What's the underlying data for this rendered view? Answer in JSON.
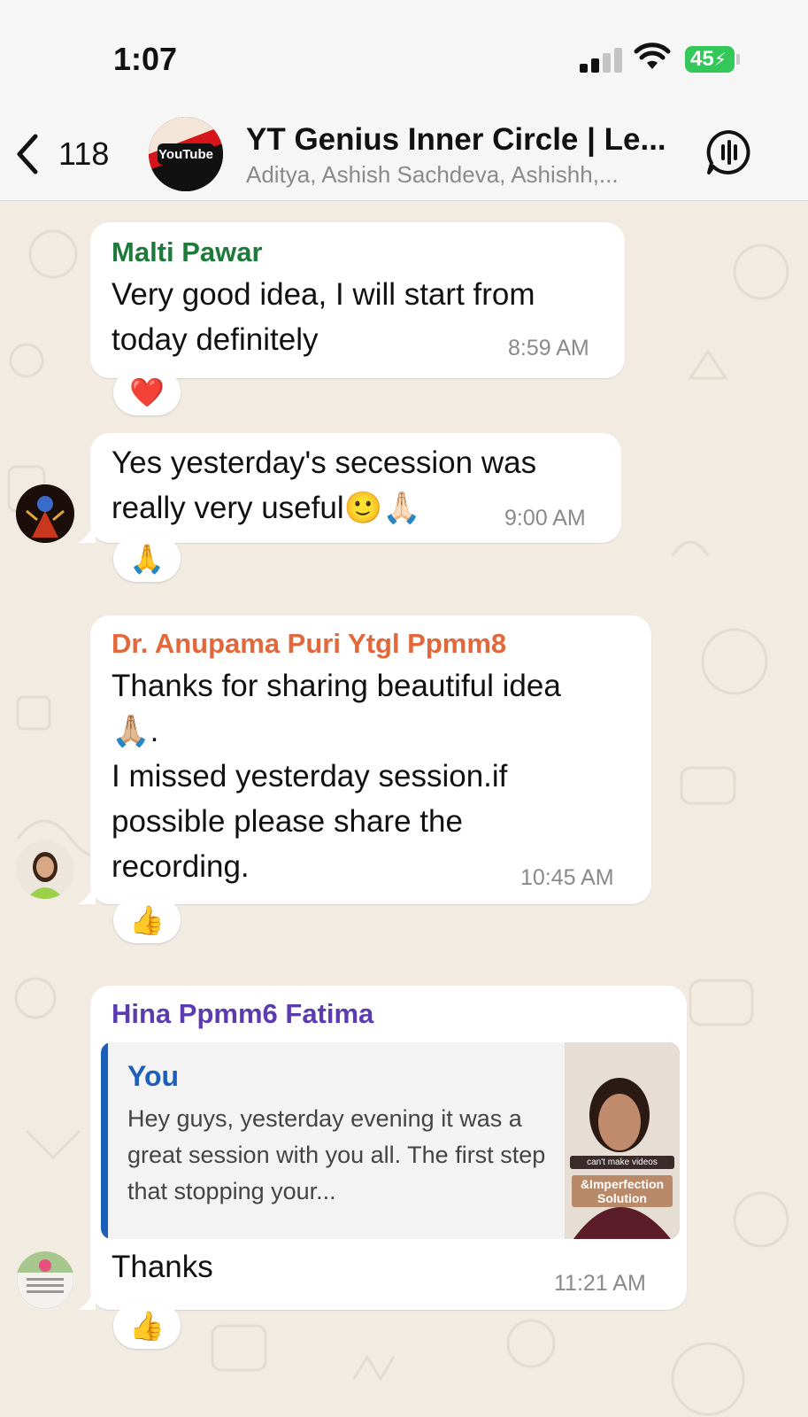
{
  "status_bar": {
    "time": "1:07",
    "battery": "45"
  },
  "header": {
    "back_count": "118",
    "group_title": "YT Genius Inner Circle | Le...",
    "group_members": "Aditya, Ashish Sachdeva, Ashishh,...",
    "avatar_text": "YouTube"
  },
  "messages": [
    {
      "sender": "Malti Pawar",
      "sender_color": "#1e7a3a",
      "text_lines": [
        "Very good idea, I will start from",
        "today definitely"
      ],
      "time": "8:59 AM",
      "reaction": "❤️"
    },
    {
      "sender": "",
      "text_lines": [
        "Yes yesterday's secession was",
        "really very useful🙂🙏🏻"
      ],
      "time": "9:00 AM",
      "reaction": "🙏"
    },
    {
      "sender": "Dr. Anupama Puri Ytgl Ppmm8",
      "sender_color": "#e2673a",
      "text_lines": [
        "Thanks for sharing beautiful idea",
        "🙏🏼.",
        "I missed yesterday session.if",
        "possible please share the",
        "recording."
      ],
      "time": "10:45 AM",
      "reaction": "👍"
    },
    {
      "sender": "Hina Ppmm6 Fatima",
      "sender_color": "#5b3bb0",
      "quote": {
        "author": "You",
        "text": "Hey guys, yesterday evening it was a great session with you all. The first step that stopping your...",
        "thumb_caption": "can't make videos",
        "thumb_caption2": "&Imperfection Solution"
      },
      "text_lines": [
        "Thanks"
      ],
      "time": "11:21 AM",
      "reaction": "👍"
    }
  ],
  "colors": {
    "accent_blue": "#1c5fb8",
    "battery_green": "#34c759",
    "chat_background": "#f1ebe2"
  }
}
